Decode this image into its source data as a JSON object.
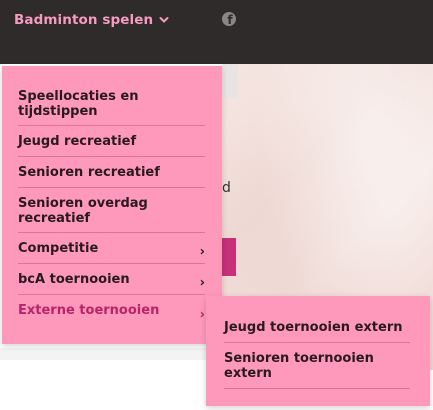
{
  "header": {
    "nav_label": "Badminton spelen",
    "nav_icon": "chevron-down-icon",
    "social_icon": "facebook-icon"
  },
  "hero": {
    "partial_text": "d"
  },
  "menu": {
    "items": [
      {
        "label": "Speellocaties en tijdstippen",
        "has_submenu": false
      },
      {
        "label": "Jeugd recreatief",
        "has_submenu": false
      },
      {
        "label": "Senioren recreatief",
        "has_submenu": false
      },
      {
        "label": "Senioren overdag recreatief",
        "has_submenu": false
      },
      {
        "label": "Competitie",
        "has_submenu": true
      },
      {
        "label": "bcA toernooien",
        "has_submenu": true
      },
      {
        "label": "Externe toernooien",
        "has_submenu": true,
        "active": true
      }
    ],
    "chevron": "›"
  },
  "submenu": {
    "items": [
      {
        "label": "Jeugd toernooien extern"
      },
      {
        "label": "Senioren toernooien extern"
      }
    ]
  },
  "colors": {
    "topbar": "#2f2b2b",
    "menu_bg": "#ff99bb",
    "accent": "#f59ac0",
    "active_text": "#b8236a"
  }
}
